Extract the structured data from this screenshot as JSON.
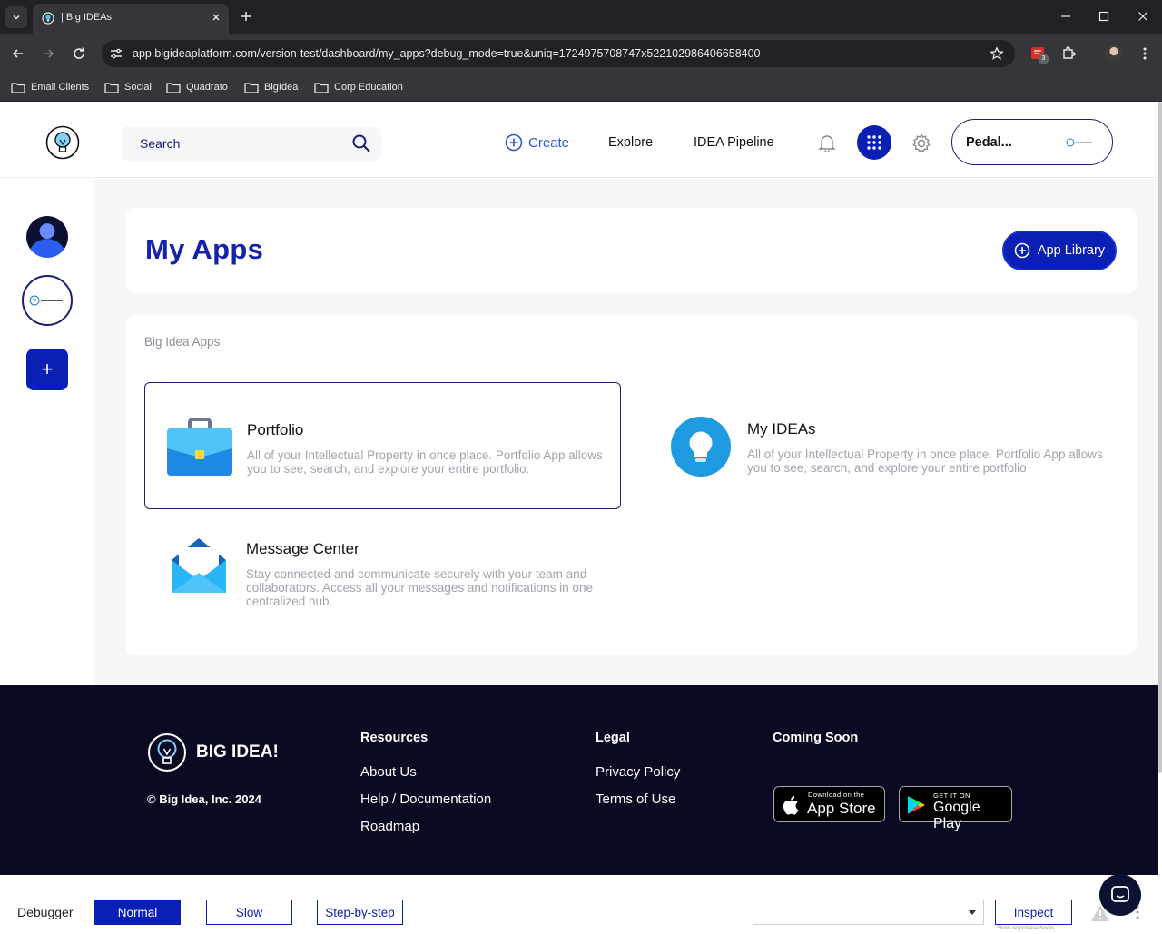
{
  "browser": {
    "tab_title": "| Big IDEAs",
    "url": "app.bigideaplatform.com/version-test/dashboard/my_apps?debug_mode=true&uniq=1724975708747x522102986406658400",
    "extension_badge": "3",
    "bookmarks": [
      "Email Clients",
      "Social",
      "Quadrato",
      "BigIdea",
      "Corp Education"
    ]
  },
  "header": {
    "search_placeholder": "Search",
    "create_label": "Create",
    "nav": [
      "Explore",
      "IDEA Pipeline"
    ],
    "profile_name": "Pedal..."
  },
  "page": {
    "title": "My Apps",
    "app_library_label": "App Library",
    "section_label": "Big Idea Apps",
    "apps": [
      {
        "name": "Portfolio",
        "description": "All of your Intellectual Property in once place. Portfolio App allows you to see, search, and explore your entire portfolio.",
        "icon": "briefcase-icon"
      },
      {
        "name": "My IDEAs",
        "description": "All of your Intellectual Property in once place. Portfolio App allows you to see, search, and explore your entire portfolio",
        "icon": "lightbulb-icon"
      },
      {
        "name": "Message Center",
        "description": "Stay connected and communicate securely with your team and collaborators. Access all your messages and notifications in one centralized hub.",
        "icon": "envelope-icon"
      }
    ]
  },
  "footer": {
    "brand": "BIG IDEA!",
    "copyright": "© Big Idea, Inc. 2024",
    "resources_heading": "Resources",
    "resources": [
      "About Us",
      "Help / Documentation",
      "Roadmap"
    ],
    "legal_heading": "Legal",
    "legal": [
      "Privacy Policy",
      "Terms of Use"
    ],
    "coming_soon_heading": "Coming Soon",
    "app_store_small": "Download on the",
    "app_store_big": "App Store",
    "google_play_small": "GET IT ON",
    "google_play_big": "Google Play"
  },
  "debugger": {
    "label": "Debugger",
    "modes": [
      "Normal",
      "Slow",
      "Step-by-step"
    ],
    "active_mode": "Normal",
    "inspect_label": "Inspect",
    "small_note": "Show responsive boxes"
  },
  "colors": {
    "brand_blue": "#0a1fb4",
    "title_blue": "#1423a8",
    "footer_bg": "#0b0a23"
  }
}
